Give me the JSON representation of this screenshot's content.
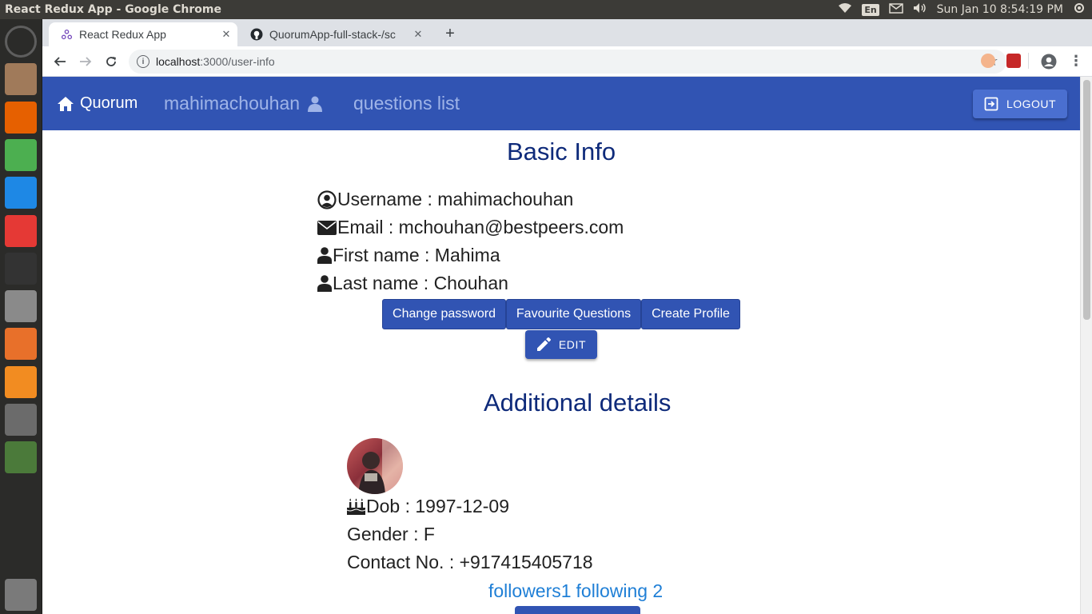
{
  "os": {
    "window_title": "React Redux App - Google Chrome",
    "keyboard_layout": "En",
    "clock": "Sun Jan 10  8:54:19 PM"
  },
  "launcher": {
    "apps": [
      {
        "name": "dash-home-icon",
        "color": "#5e5e5e"
      },
      {
        "name": "files-icon",
        "color": "#a07a5a"
      },
      {
        "name": "firefox-icon",
        "color": "#e66000"
      },
      {
        "name": "chrome-icon",
        "color": "#4caf50"
      },
      {
        "name": "vscode-icon",
        "color": "#1e88e5"
      },
      {
        "name": "anydesk-icon",
        "color": "#e53935"
      },
      {
        "name": "terminal-icon",
        "color": "#333333"
      },
      {
        "name": "text-editor-icon",
        "color": "#8a8a8a"
      },
      {
        "name": "software-center-icon",
        "color": "#e8702a"
      },
      {
        "name": "sublime-text-icon",
        "color": "#f28c21"
      },
      {
        "name": "system-settings-icon",
        "color": "#6b6b6b"
      },
      {
        "name": "software-updater-icon",
        "color": "#4b7a3a"
      },
      {
        "name": "trash-icon",
        "color": "#7a7a7a"
      }
    ]
  },
  "browser": {
    "tabs": [
      {
        "title": "React Redux App",
        "icon": "redux-icon",
        "active": true
      },
      {
        "title": "QuorumApp-full-stack-/sc",
        "icon": "github-icon",
        "active": false
      }
    ],
    "url": {
      "host": "localhost",
      "path": ":3000/user-info"
    }
  },
  "navbar": {
    "brand": "Quorum",
    "username": "mahimachouhan",
    "questions_link": "questions list",
    "logout_label": "LOGOUT"
  },
  "basic_info": {
    "title": "Basic Info",
    "username": "Username : mahimachouhan",
    "email": "Email : mchouhan@bestpeers.com",
    "first_name": "First name : Mahima",
    "last_name": "Last name : Chouhan",
    "buttons": {
      "change_password": "Change password",
      "favourite_questions": "Favourite Questions",
      "create_profile": "Create Profile",
      "edit": "EDIT"
    }
  },
  "additional": {
    "title": "Additional details",
    "dob": "Dob : 1997-12-09",
    "gender": "Gender : F",
    "contact": "Contact No. : +917415405718",
    "followers": "followers1",
    "following": "following 2"
  }
}
